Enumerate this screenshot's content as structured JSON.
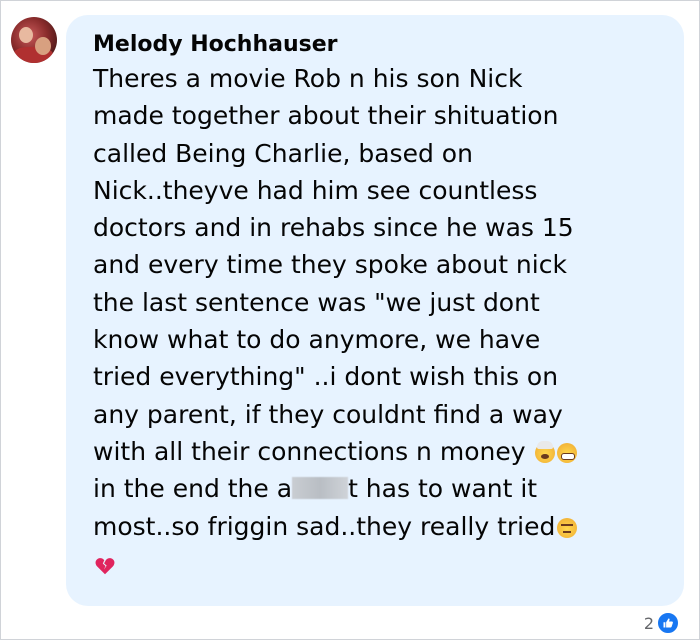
{
  "comment": {
    "author": "Melody Hochhauser",
    "lines": [
      "Theres a movie Rob n his son Nick",
      "made together about their shituation",
      "called Being Charlie, based on",
      "Nick..theyve had him see countless",
      "doctors and in rehabs since he was 15",
      "and every time they spoke about nick",
      "the last sentence was \"we just dont",
      "know what to do anymore, we have",
      "tried everything\" ..i dont wish this on",
      "any parent, if they couldnt find a way",
      "with all their connections n money"
    ],
    "line12_before": "in the end the a",
    "line12_after": "t has to want it",
    "line13": "most..so friggin sad..they really tried",
    "emojis": [
      "exploding-head-emoji",
      "tired-face-emoji",
      "disappointed-face-emoji",
      "broken-heart-emoji"
    ]
  },
  "reactions": {
    "count": "2",
    "type": "like-icon"
  },
  "colors": {
    "bubble_bg": "#e7f3ff",
    "like_blue": "#1877f2",
    "text": "#050505",
    "muted": "#65676b",
    "heart": "#e0245e"
  }
}
